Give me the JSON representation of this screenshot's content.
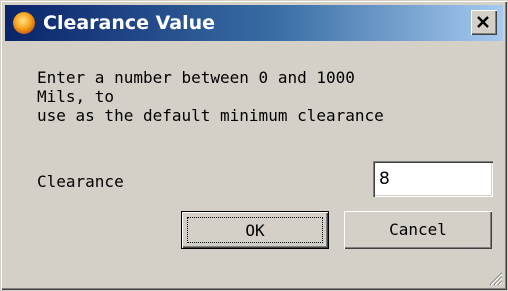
{
  "window": {
    "title": "Clearance Value",
    "icon": "app-flame-icon",
    "close_icon": "close-icon"
  },
  "message": {
    "line1": "Enter a number between 0 and 1000",
    "line2": "Mils, to",
    "line3": "use as the default minimum clearance"
  },
  "field": {
    "label": "Clearance",
    "value": "8"
  },
  "buttons": {
    "ok_label": "OK",
    "cancel_label": "Cancel"
  },
  "colors": {
    "titlebar_start": "#0a246a",
    "titlebar_end": "#a6caf0",
    "dialog_face": "#d4d0c8"
  }
}
